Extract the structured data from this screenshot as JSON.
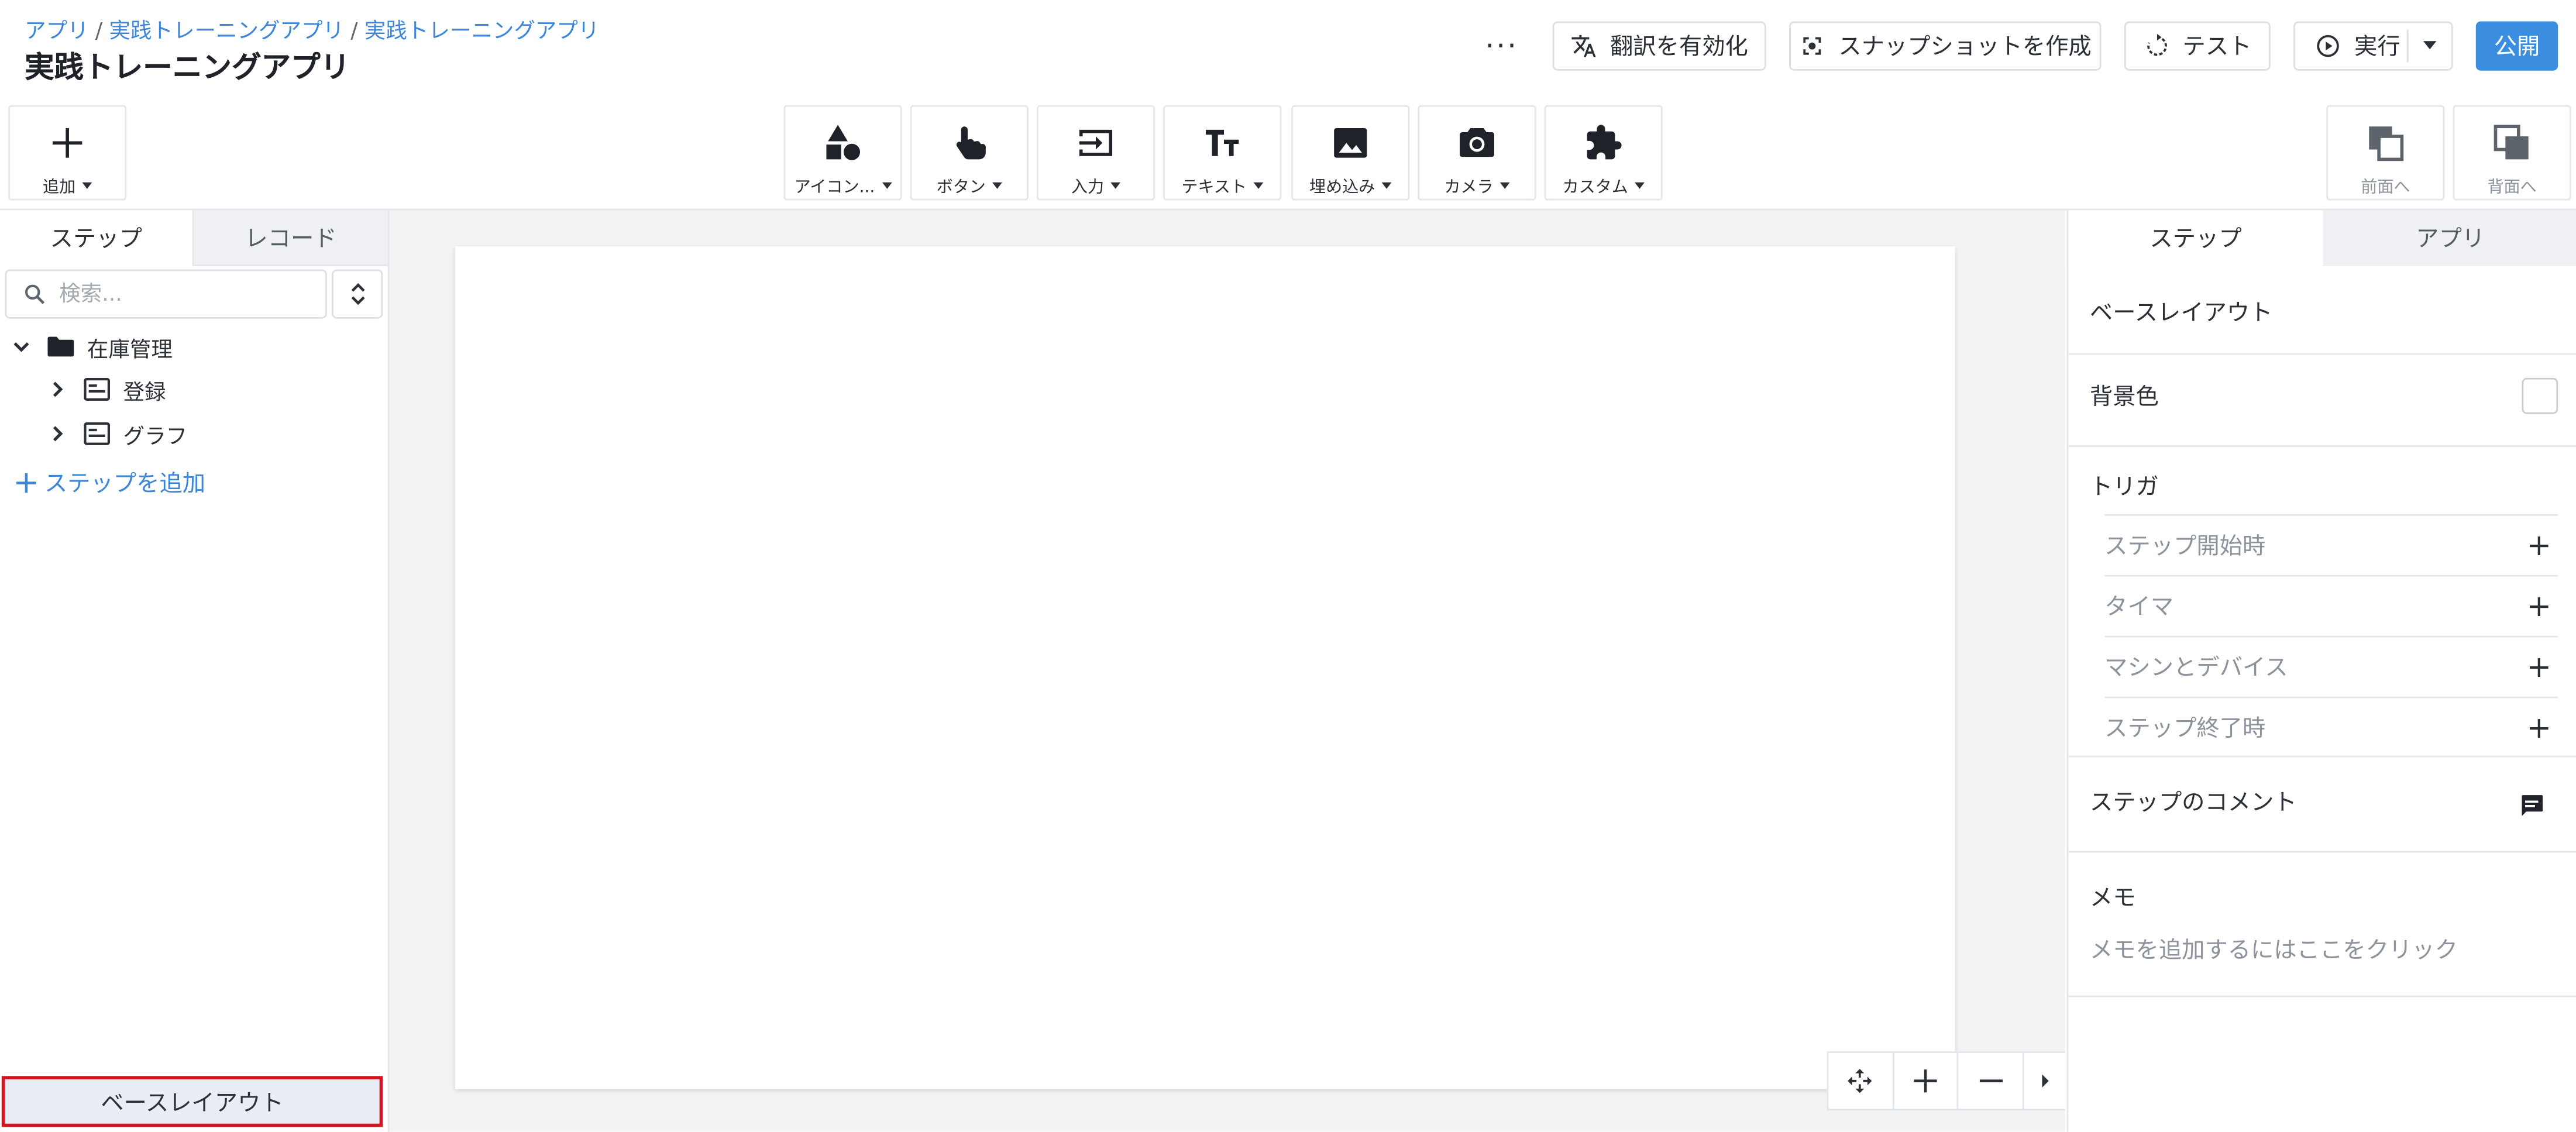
{
  "header": {
    "breadcrumb": [
      "アプリ",
      "実践トレーニングアプリ",
      "実践トレーニングアプリ"
    ],
    "breadcrumb_sep": "/",
    "title": "実践トレーニングアプリ",
    "more_label": "···",
    "translate_label": "翻訳を有効化",
    "snapshot_label": "スナップショットを作成",
    "test_label": "テスト",
    "run_label": "実行",
    "publish_label": "公開"
  },
  "toolbar": {
    "add_label": "追加",
    "tools": [
      {
        "label": "アイコン...",
        "icon": "shapes-icon"
      },
      {
        "label": "ボタン",
        "icon": "pointer-hand-icon"
      },
      {
        "label": "入力",
        "icon": "input-icon"
      },
      {
        "label": "テキスト",
        "icon": "text-icon"
      },
      {
        "label": "埋め込み",
        "icon": "image-icon"
      },
      {
        "label": "カメラ",
        "icon": "camera-icon"
      },
      {
        "label": "カスタム",
        "icon": "puzzle-icon"
      }
    ],
    "bring_forward_label": "前面へ",
    "send_backward_label": "背面へ"
  },
  "left_panel": {
    "tabs": [
      "ステップ",
      "レコード"
    ],
    "search_placeholder": "検索...",
    "tree": {
      "folder": "在庫管理",
      "items": [
        "登録",
        "グラフ"
      ]
    },
    "add_step_label": "ステップを追加",
    "base_layout_label": "ベースレイアウト"
  },
  "right_panel": {
    "tabs": [
      "ステップ",
      "アプリ"
    ],
    "base_layout_title": "ベースレイアウト",
    "background_color_label": "背景色",
    "background_color": "#ffffff",
    "trigger_title": "トリガ",
    "triggers": [
      "ステップ開始時",
      "タイマ",
      "マシンとデバイス",
      "ステップ終了時"
    ],
    "step_comment_label": "ステップのコメント",
    "memo_title": "メモ",
    "memo_hint": "メモを追加するにはここをクリック"
  },
  "colors": {
    "accent": "#3b8de0",
    "link": "#3b86d8",
    "selection_border": "#d9121e"
  }
}
